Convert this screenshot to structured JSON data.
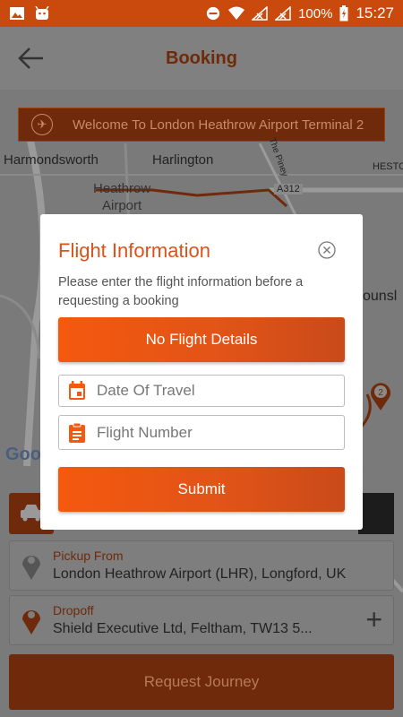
{
  "status_bar": {
    "battery": "100%",
    "time": "15:27"
  },
  "appbar": {
    "title": "Booking"
  },
  "welcome_banner": {
    "text": "Welcome To London Heathrow Airport Terminal 2"
  },
  "map_labels": {
    "harmondsworth": "Harmondsworth",
    "harlington": "Harlington",
    "heathrow": "Heathrow",
    "airport": "Airport",
    "road": "A312",
    "piney": "The Piney",
    "hesto": "HESTO",
    "ounsl": "ounsl",
    "google": "Goo"
  },
  "dialog": {
    "title": "Flight Information",
    "description": "Please enter the flight information before a requesting a booking",
    "no_flight_button": "No Flight Details",
    "date_placeholder": "Date Of Travel",
    "flight_placeholder": "Flight Number",
    "submit_button": "Submit"
  },
  "pickup": {
    "label": "Pickup From",
    "value": "London Heathrow Airport (LHR), Longford, UK"
  },
  "dropoff": {
    "label": "Dropoff",
    "value": "Shield Executive Ltd, Feltham, TW13 5..."
  },
  "request_button": "Request Journey",
  "marker_number": "2",
  "colors": {
    "accent": "#f5590f",
    "status_bar": "#c94a0c",
    "brand_dark": "#6e2a0a"
  }
}
